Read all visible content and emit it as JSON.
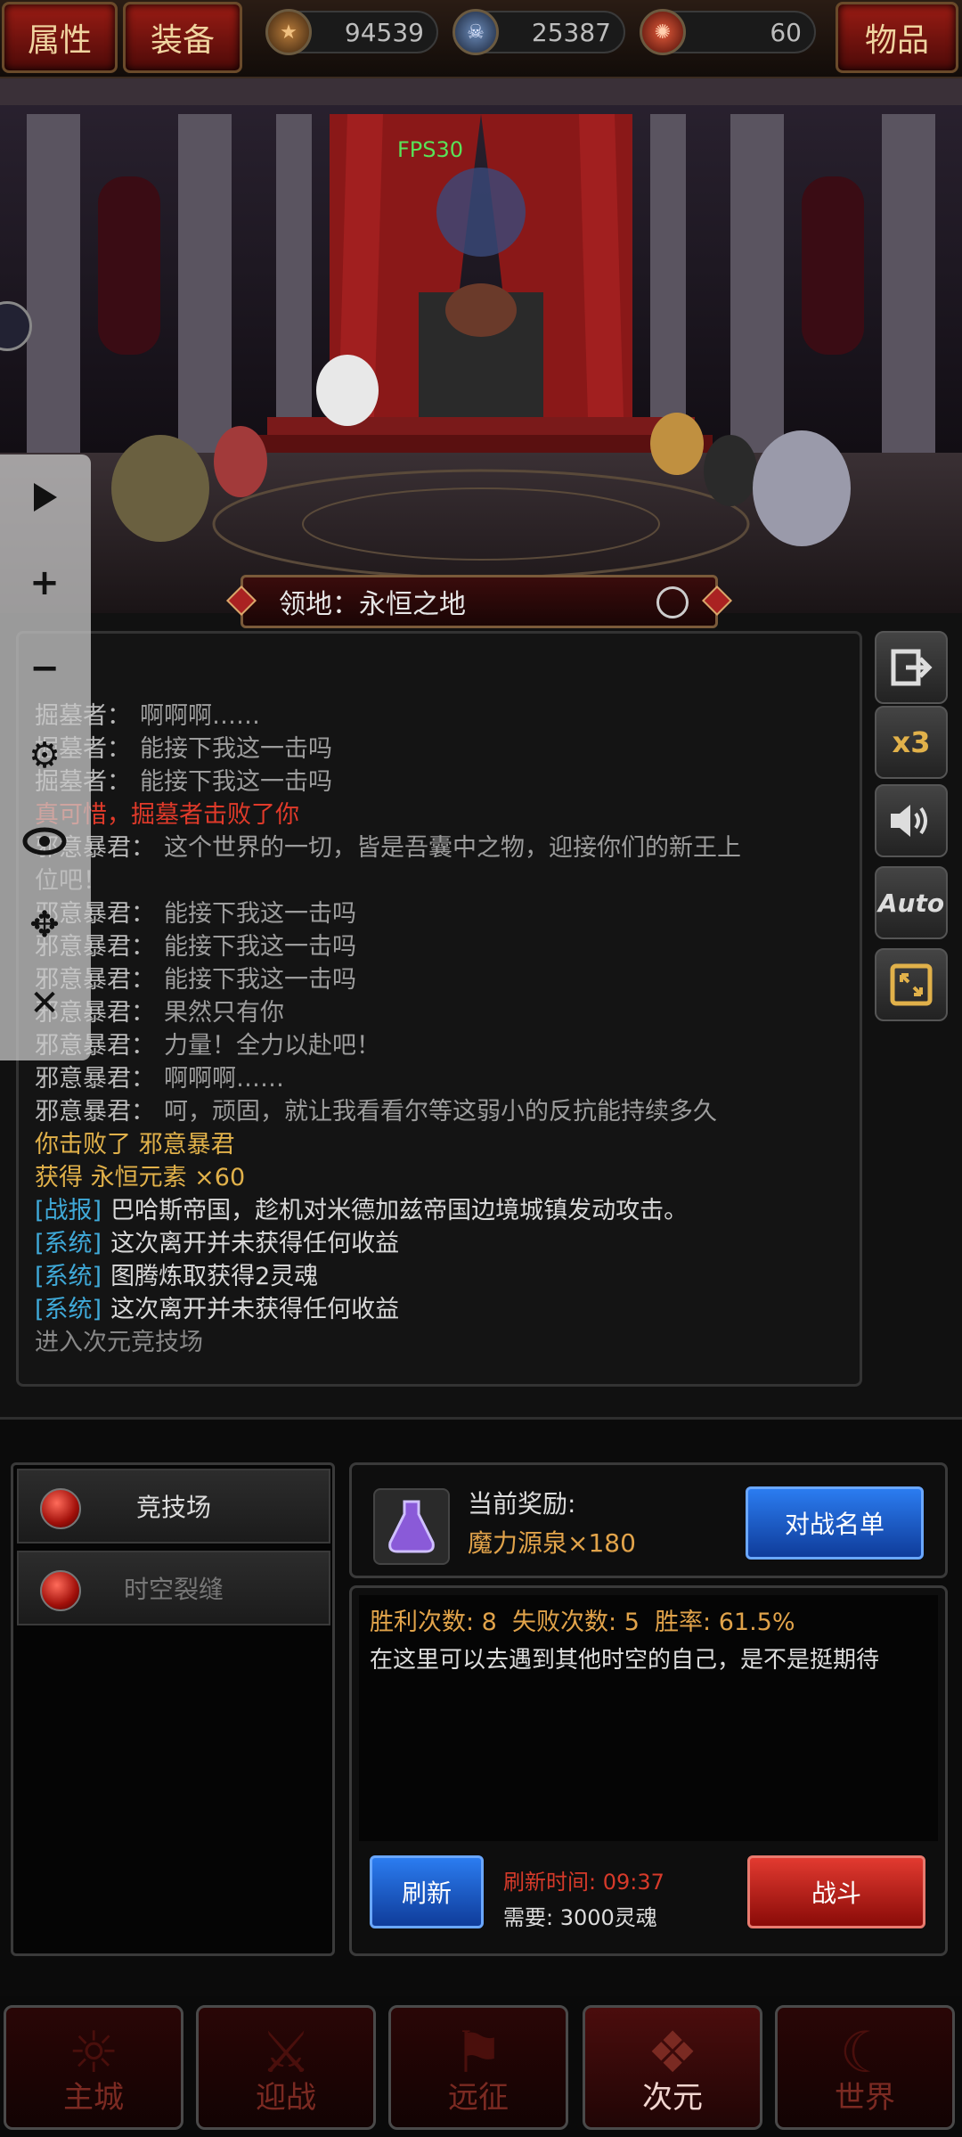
{
  "top": {
    "attr_label": "属性",
    "equip_label": "装备",
    "items_label": "物品",
    "resources": [
      {
        "icon": "star-coin-icon",
        "value": "94539"
      },
      {
        "icon": "skull-coin-icon",
        "value": "25387"
      },
      {
        "icon": "swirl-coin-icon",
        "value": "60"
      }
    ]
  },
  "scene": {
    "fps": "FPS30",
    "zone_label": "领地：永恒之地"
  },
  "log": {
    "lines": [
      {
        "speaker": "掘墓者：",
        "text": "啊啊啊……",
        "color": "normal"
      },
      {
        "speaker": "掘墓者：",
        "text": "能接下我这一击吗",
        "color": "normal"
      },
      {
        "speaker": "掘墓者：",
        "text": "能接下我这一击吗",
        "color": "normal"
      },
      {
        "speaker": "",
        "text": "真可惜，掘墓者击败了你",
        "color": "#e03a2a"
      },
      {
        "speaker": "邪意暴君：",
        "text": "这个世界的一切，皆是吾囊中之物，迎接你们的新王上",
        "color": "normal"
      },
      {
        "speaker": "",
        "text": "位吧！",
        "color": "normal"
      },
      {
        "speaker": "邪意暴君：",
        "text": "能接下我这一击吗",
        "color": "normal"
      },
      {
        "speaker": "邪意暴君：",
        "text": "能接下我这一击吗",
        "color": "normal"
      },
      {
        "speaker": "邪意暴君：",
        "text": "能接下我这一击吗",
        "color": "normal"
      },
      {
        "speaker": "邪意暴君：",
        "text": "果然只有你",
        "color": "normal"
      },
      {
        "speaker": "邪意暴君：",
        "text": "力量！全力以赴吧！",
        "color": "normal"
      },
      {
        "speaker": "邪意暴君：",
        "text": "啊啊啊……",
        "color": "normal"
      },
      {
        "speaker": "邪意暴君：",
        "text": "呵，顽固，就让我看看尔等这弱小的反抗能持续多久",
        "color": "normal"
      },
      {
        "speaker": "",
        "text": "你击败了 邪意暴君",
        "color": "#e1b14a"
      },
      {
        "speaker": "",
        "text": "获得 永恒元素 ×60",
        "color": "#e1b14a"
      },
      {
        "speaker": "[战报]",
        "text": "巴哈斯帝国，趁机对米德加兹帝国边境城镇发动攻击。",
        "color": "tag"
      },
      {
        "speaker": "[系统]",
        "text": "这次离开并未获得任何收益",
        "color": "tag"
      },
      {
        "speaker": "[系统]",
        "text": "图腾炼取获得2灵魂",
        "color": "tag"
      },
      {
        "speaker": "[系统]",
        "text": "这次离开并未获得任何收益",
        "color": "tag"
      },
      {
        "speaker": "",
        "text": "进入次元竞技场",
        "color": "#888"
      }
    ]
  },
  "side_buttons": {
    "speed": "x3",
    "auto": "Auto"
  },
  "float_tools": [
    "play-icon",
    "plus-icon",
    "minus-icon",
    "gear-icon",
    "eye-icon",
    "move-icon",
    "close-icon"
  ],
  "panel": {
    "tabs": [
      "竞技场",
      "时空裂缝"
    ],
    "reward_title": "当前奖励:",
    "reward_value": "魔力源泉×180",
    "battle_list": "对战名单",
    "stats": "胜利次数: 8  失败次数: 5  胜率: 61.5%",
    "desc": "在这里可以去遇到其他时空的自己，是不是挺期待",
    "refresh": "刷新",
    "refresh_time_label": "刷新时间: 09:37",
    "need": "需要: 3000灵魂",
    "fight": "战斗"
  },
  "nav": {
    "items": [
      "主城",
      "迎战",
      "远征",
      "次元",
      "世界"
    ],
    "active": "次元"
  }
}
